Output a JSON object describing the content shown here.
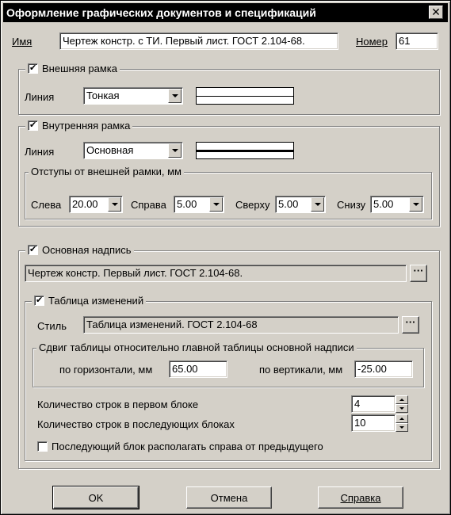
{
  "window": {
    "title": "Оформление графических документов и спецификаций",
    "close_glyph": "✕"
  },
  "name": {
    "label": "Имя",
    "value": "Чертеж констр. с ТИ. Первый лист. ГОСТ 2.104-68."
  },
  "number": {
    "label": "Номер",
    "value": "61"
  },
  "outer_frame": {
    "title": "Внешняя рамка",
    "checked": true,
    "line_label": "Линия",
    "line_value": "Тонкая"
  },
  "inner_frame": {
    "title": "Внутренняя рамка",
    "checked": true,
    "line_label": "Линия",
    "line_value": "Основная",
    "offsets": {
      "title": "Отступы от внешней рамки, мм",
      "left_label": "Слева",
      "left_value": "20.00",
      "right_label": "Справа",
      "right_value": "5.00",
      "top_label": "Сверху",
      "top_value": "5.00",
      "bottom_label": "Снизу",
      "bottom_value": "5.00"
    }
  },
  "title_block": {
    "title": "Основная надпись",
    "checked": true,
    "value": "Чертеж констр. Первый лист. ГОСТ 2.104-68.",
    "browse_label": "···",
    "changes_table": {
      "title": "Таблица изменений",
      "checked": true,
      "style_label": "Стиль",
      "style_value": "Таблица изменений. ГОСТ 2.104-68",
      "browse_label": "···",
      "shift": {
        "title": "Сдвиг таблицы относительно главной таблицы основной надписи",
        "horizontal_label": "по горизонтали, мм",
        "horizontal_value": "65.00",
        "vertical_label": "по вертикали, мм",
        "vertical_value": "-25.00"
      },
      "rows_first_label": "Количество строк в первом блоке",
      "rows_first_value": "4",
      "rows_next_label": "Количество строк в последующих блоках",
      "rows_next_value": "10",
      "place_right_label": "Последующий блок располагать справа от предыдущего",
      "place_right_checked": false
    }
  },
  "buttons": {
    "ok": "OK",
    "cancel": "Отмена",
    "help": "Справка"
  },
  "colors": {
    "face": "#d4d0c8",
    "title_bar": "#000000",
    "shadow": "#808080"
  }
}
